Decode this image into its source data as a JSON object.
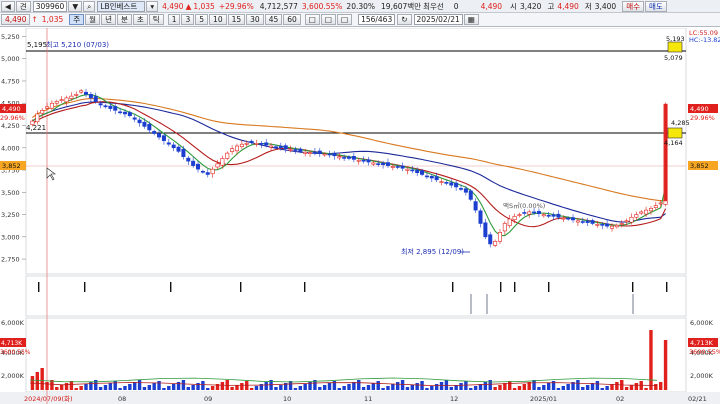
{
  "toolbar": {
    "code": "309960",
    "name": "LB인베스트",
    "price": "4,490",
    "change": "1,035",
    "change_pct": "+29.96%",
    "volume": "4,712,577",
    "volume_ratio": "3,600.55%",
    "turnover": "20.30%",
    "amount": "19,607백만",
    "min_label": "최우선",
    "min_value": "0",
    "price2": "4,490",
    "open_label": "시",
    "open": "3,420",
    "high_label": "고",
    "high": "4,490",
    "low_label": "저",
    "low": "3,400",
    "buy_label": "매수",
    "sell_label": "매도",
    "mode_label": "견",
    "periods": [
      "주",
      "월",
      "년",
      "분",
      "초",
      "틱"
    ],
    "intervals": [
      "1",
      "3",
      "5",
      "10",
      "15",
      "30",
      "45",
      "60"
    ],
    "page": "156/463",
    "date": "2025/02/21"
  },
  "chart_data": {
    "type": "candlestick",
    "price_axis": {
      "ticks": [
        "5,250",
        "5,000",
        "4,750",
        "4,500",
        "4,250",
        "4,000",
        "3,750",
        "3,500",
        "3,250",
        "3,000",
        "2,750"
      ],
      "min": 2650,
      "max": 5300
    },
    "volume_axis": {
      "ticks": [
        "6,000K",
        "4,000K",
        "2,000K"
      ]
    },
    "x_axis": {
      "labels": [
        "2024/07/09(화)",
        "08",
        "09",
        "10",
        "11",
        "12",
        "2025/01",
        "02",
        "02/21"
      ]
    },
    "annotations": {
      "high_note": "최고 5,210 (07/03)",
      "low_note": "최저 2,895 (12/09)",
      "split_note": "액S㎡(0.00%)",
      "left_level": "4,221",
      "line1_left": "5,195",
      "line1_right_top": "5,193",
      "line1_right_bottom": "5,079",
      "line2_right_top": "4,285",
      "line2_right_bottom": "4,164",
      "lc": "LC:55.09",
      "hc": "HC:-13.82"
    },
    "right_badges": {
      "price": "4,490",
      "pct": "29.96%",
      "prev": "3,852",
      "vol": "4,713K",
      "vol_pct": "3600.55%"
    },
    "left_badges": {
      "price": "4,490",
      "pct": "29.96%",
      "prev": "3,852",
      "vol": "4,713K",
      "vol_pct": "3600.55%"
    },
    "closes": [
      4300,
      4380,
      4420,
      4460,
      4500,
      4520,
      4540,
      4560,
      4580,
      4600,
      4640,
      4600,
      4560,
      4520,
      4480,
      4460,
      4440,
      4420,
      4400,
      4380,
      4360,
      4320,
      4280,
      4240,
      4200,
      4160,
      4120,
      4080,
      4040,
      4000,
      3960,
      3900,
      3850,
      3800,
      3760,
      3730,
      3700,
      3760,
      3820,
      3880,
      3940,
      3990,
      4020,
      4040,
      4050,
      4060,
      4050,
      4040,
      4030,
      4020,
      4010,
      4000,
      3990,
      3980,
      3970,
      3960,
      3950,
      3945,
      3940,
      3935,
      3930,
      3920,
      3910,
      3900,
      3890,
      3880,
      3870,
      3860,
      3850,
      3840,
      3830,
      3820,
      3810,
      3800,
      3790,
      3780,
      3770,
      3760,
      3740,
      3720,
      3700,
      3680,
      3660,
      3640,
      3620,
      3600,
      3580,
      3560,
      3540,
      3500,
      3420,
      3300,
      3150,
      3000,
      2920,
      2950,
      3050,
      3150,
      3200,
      3230,
      3250,
      3270,
      3280,
      3270,
      3260,
      3250,
      3240,
      3230,
      3220,
      3210,
      3200,
      3190,
      3180,
      3170,
      3160,
      3150,
      3140,
      3130,
      3120,
      3120,
      3130,
      3150,
      3180,
      3220,
      3250,
      3280,
      3300,
      3320,
      3350,
      3380,
      4490
    ],
    "ma_note": "moving averages shown as smoothed lines"
  }
}
